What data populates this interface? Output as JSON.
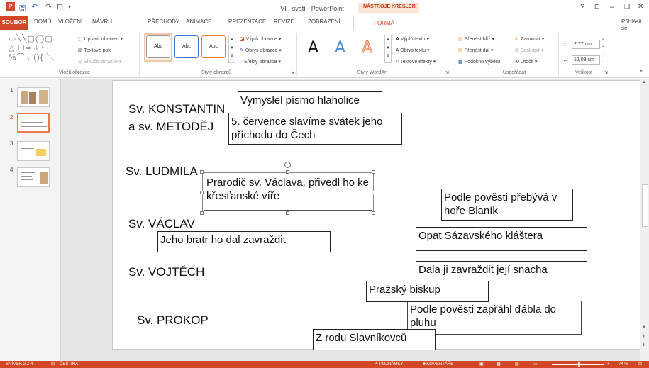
{
  "window": {
    "title": "VI - svatí - PowerPoint",
    "context_tab_group": "NÁSTROJE KRESLENÍ",
    "help": "?",
    "ribbon_options": "⊡",
    "minimize": "–",
    "restore": "❐",
    "close": "✕",
    "sign_in": "Přihlásit se"
  },
  "quick_access": {
    "app_icon": "P",
    "save": "🖫",
    "undo": "↶",
    "redo": "↷",
    "present": "⊡",
    "customize": "▾"
  },
  "tabs": [
    "SOUBOR",
    "DOMŮ",
    "VLOŽENÍ",
    "NÁVRH",
    "PŘECHODY",
    "ANIMACE",
    "PREZENTACE",
    "REVIZE",
    "ZOBRAZENÍ",
    "FORMÁT"
  ],
  "ribbon": {
    "insert_shapes": {
      "label": "Vložit obrazce",
      "shapes_row1": "▭╲╲▢◯▢",
      "shapes_row2": "△⅂⅂⇨⇩◔",
      "shapes_row3": "⅍⌒╮(){ ╲",
      "edit_shape": "Upravit obrazec ▾",
      "text_box": "Textové pole",
      "merge_shapes": "Sloučit obrazce ▾"
    },
    "shape_styles": {
      "label": "Styly obrazců",
      "samples": [
        "Abc",
        "Abc",
        "Abc"
      ],
      "fill": "Výplň obrazce ▾",
      "outline": "Obrys obrazce ▾",
      "effects": "Efekty obrazce ▾"
    },
    "wordart_styles": {
      "label": "Styly WordArt",
      "letters": [
        "A",
        "A",
        "A"
      ],
      "text_fill": "Výplň textu ▾",
      "text_outline": "Obrys textu ▾",
      "text_effects": "Textové efekty ▾"
    },
    "arrange": {
      "label": "Uspořádat",
      "bring_forward": "Přenést blíž ▾",
      "send_backward": "Přenést dál ▾",
      "selection_pane": "Podokno výběru",
      "align": "Zarovnat ▾",
      "group": "Seskupit ▾",
      "rotate": "Otočit ▾"
    },
    "size": {
      "label": "Velikost",
      "height": "2,77 cm",
      "width": "12,08 cm"
    },
    "collapse": "^"
  },
  "thumbnails": [
    {
      "number": "1"
    },
    {
      "number": "2"
    },
    {
      "number": "3"
    },
    {
      "number": "4"
    }
  ],
  "slide": {
    "saints": {
      "konstantin": "Sv. KONSTANTIN",
      "metodej": "a sv. METODĚJ",
      "ludmila": "Sv. LUDMILA",
      "vaclav": "Sv. VÁCLAV",
      "vojtech": "Sv. VOJTĚCH",
      "prokop": "Sv. PROKOP"
    },
    "boxes": {
      "hlaholice": "Vymyslel písmo hlaholice",
      "svatek": "5. července slavíme svátek jeho příchodu do Čech",
      "praroditel": "Prarodič sv. Václava, přivedl ho ke křesťanské víře",
      "blanik": "Podle pověsti přebývá v hoře Blaník",
      "sazava": "Opat Sázavského kláštera",
      "bratr": "Jeho bratr ho dal zavraždit",
      "snacha": "Dala ji zavraždit její snacha",
      "biskup": "Pražský biskup",
      "dabel": "Podle pověsti zapřáhl ďábla do pluhu",
      "slavnikovci": "Z rodu Slavníkovců"
    }
  },
  "statusbar": {
    "slide": "SNÍMEK 2 Z 4",
    "language": "ČEŠTINA",
    "notes": "≐ POZNÁMKY",
    "comments": "■ KOMENTÁŘE",
    "zoom": "74 %"
  },
  "colors": {
    "accent": "#d24726",
    "context": "#c43e1c"
  }
}
